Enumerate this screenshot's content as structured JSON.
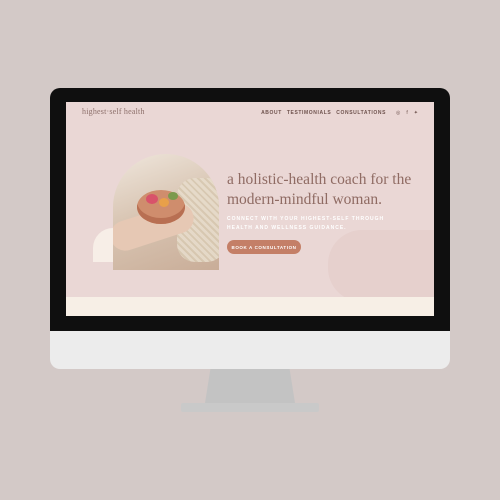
{
  "site": {
    "logo": "highest·self health",
    "nav": [
      {
        "label": "ABOUT"
      },
      {
        "label": "TESTIMONIALS"
      },
      {
        "label": "CONSULTATIONS"
      }
    ],
    "social": [
      {
        "icon": "instagram-icon",
        "glyph": "◎"
      },
      {
        "icon": "facebook-icon",
        "glyph": "f"
      },
      {
        "icon": "twitter-icon",
        "glyph": "✦"
      }
    ]
  },
  "hero": {
    "headline": "a holistic-health coach for the modern-mindful woman.",
    "subheadline": "CONNECT WITH YOUR HIGHEST-SELF THROUGH HEALTH AND WELLNESS GUIDANCE.",
    "cta_label": "BOOK A CONSULTATION"
  },
  "colors": {
    "background": "#d3c9c7",
    "screen": "#ead7d5",
    "accent": "#c47f67",
    "text": "#8f6b63"
  }
}
